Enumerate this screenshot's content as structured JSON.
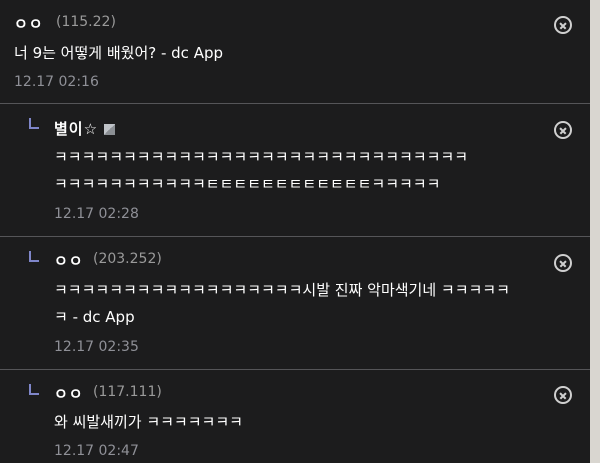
{
  "comments": [
    {
      "nick": "ㅇㅇ",
      "ip": "(115.22)",
      "text": "너 9는 어떻게 배웠어? - dc App",
      "date": "12.17 02:16"
    },
    {
      "nick": "별이☆",
      "ip": "",
      "text": "ㅋㅋㅋㅋㅋㅋㅋㅋㅋㅋㅋㅋㅋㅋㅋㅋㅋㅋㅋㅋㅋㅋㅋㅋㅋㅋㅋㅋㅋㅋ\nㅋㅋㅋㅋㅋㅋㅋㅋㅋㅋㅋㅌㅌㅌㅌㅌㅌㅌㅌㅌㅌㅌㅌㅋㅋㅋㅋㅋ",
      "date": "12.17 02:28",
      "reply": true
    },
    {
      "nick": "ㅇㅇ",
      "ip": "(203.252)",
      "text": "ㅋㅋㅋㅋㅋㅋㅋㅋㅋㅋㅋㅋㅋㅋㅋㅋㅋㅋ시발 진짜 악마색기네 ㅋㅋㅋㅋㅋ\nㅋ - dc App",
      "date": "12.17 02:35",
      "reply": true
    },
    {
      "nick": "ㅇㅇ",
      "ip": "(117.111)",
      "text": "와 씨발새끼가 ㅋㅋㅋㅋㅋㅋㅋ",
      "date": "12.17 02:47",
      "reply": true
    }
  ]
}
